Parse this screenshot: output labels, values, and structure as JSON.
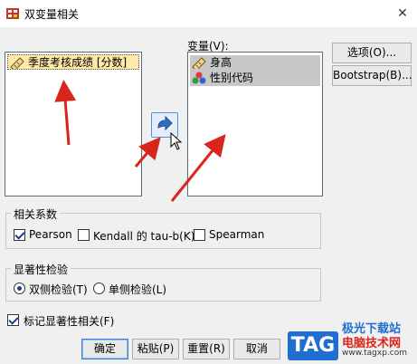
{
  "window": {
    "title": "双变量相关"
  },
  "source_list": {
    "items": [
      {
        "label": "季度考核成绩 [分数]",
        "icon": "ruler-scale-icon"
      }
    ]
  },
  "variables": {
    "label": "变量(V):",
    "items": [
      {
        "label": "身高",
        "icon": "ruler-scale-icon"
      },
      {
        "label": "性别代码",
        "icon": "nominal-balls-icon"
      }
    ]
  },
  "side_buttons": {
    "options": "选项(O)...",
    "bootstrap": "Bootstrap(B)..."
  },
  "correlation": {
    "group_label": "相关系数",
    "pearson": {
      "label": "Pearson",
      "checked": true
    },
    "kendall": {
      "label": "Kendall 的 tau-b(K)",
      "checked": false
    },
    "spearman": {
      "label": "Spearman",
      "checked": false
    }
  },
  "significance": {
    "group_label": "显著性检验",
    "two_tailed": {
      "label": "双侧检验(T)",
      "selected": true
    },
    "one_tailed": {
      "label": "单侧检验(L)",
      "selected": false
    }
  },
  "flag_significant": {
    "label": "标记显著性相关(F)",
    "checked": true
  },
  "footer_buttons": {
    "ok": "确定",
    "paste": "粘贴(P)",
    "reset": "重置(R)",
    "cancel": "取消"
  },
  "watermark": {
    "text1": "极光下载站",
    "text2": "电脑技术网",
    "brand": "TAG",
    "url": "www.tagxp.com"
  },
  "colors": {
    "annotation_arrow": "#d9261c",
    "selected_row": "#ffe9a8",
    "gray_row": "#c8c8c8"
  }
}
